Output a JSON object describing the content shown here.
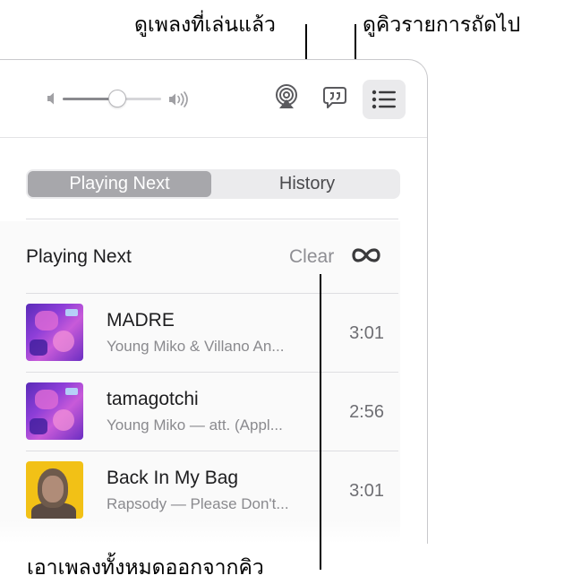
{
  "callouts": {
    "history": "ดูเพลงที่เล่นแล้ว",
    "queue": "ดูคิวรายการถัดไป",
    "clear": "เอาเพลงทั้งหมดออกจากคิว"
  },
  "toolbar": {
    "volume_level": 0.55,
    "airplay_icon": "airplay-icon",
    "lyrics_icon": "lyrics-icon",
    "queue_icon": "list-icon"
  },
  "tabs": [
    {
      "label": "Playing Next",
      "selected": true
    },
    {
      "label": "History",
      "selected": false
    }
  ],
  "section": {
    "title": "Playing Next",
    "clear_label": "Clear",
    "repeat_icon": "infinity-icon"
  },
  "tracks": [
    {
      "title": "MADRE",
      "subtitle": "Young Miko & Villano An...",
      "duration": "3:01",
      "artwork": "purple"
    },
    {
      "title": "tamagotchi",
      "subtitle": "Young Miko — att. (Appl...",
      "duration": "2:56",
      "artwork": "purple"
    },
    {
      "title": "Back In My Bag",
      "subtitle": "Rapsody — Please Don't...",
      "duration": "3:01",
      "artwork": "yellow"
    }
  ],
  "colors": {
    "segment_active": "#a7a7ab",
    "queue_button_bg": "#eaeaec",
    "secondary_text": "#8a8a8e"
  }
}
